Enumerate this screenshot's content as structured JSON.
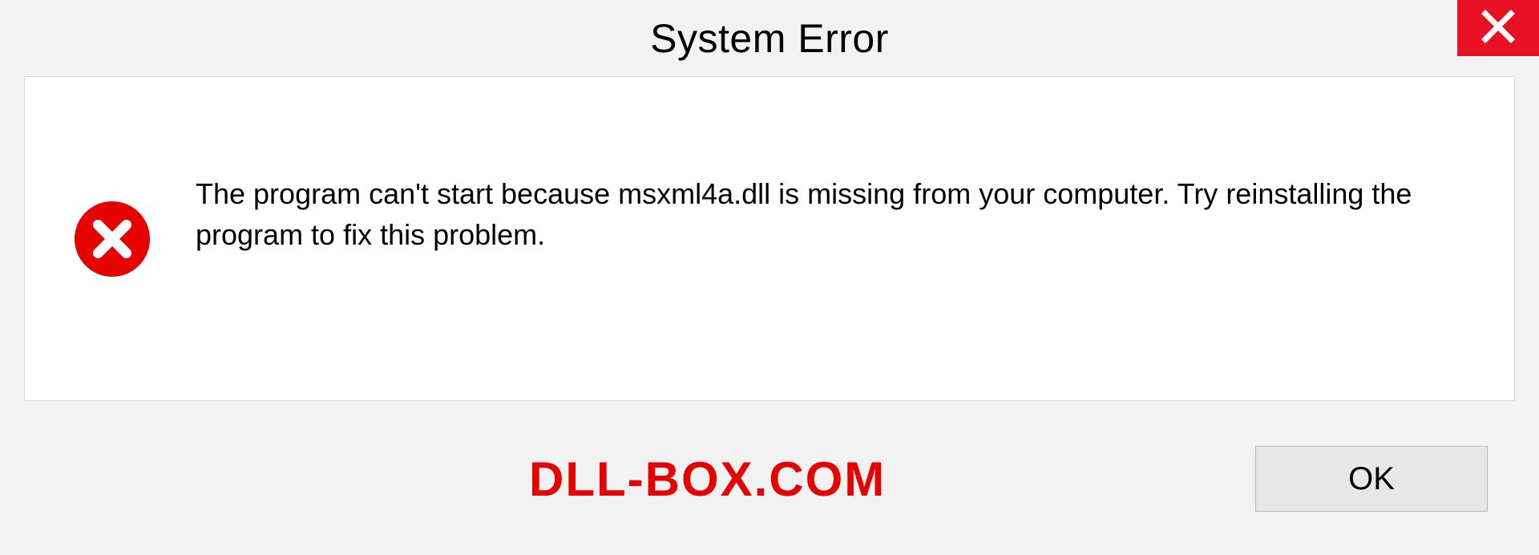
{
  "dialog": {
    "title": "System Error",
    "message": "The program can't start because msxml4a.dll is missing from your computer. Try reinstalling the program to fix this problem.",
    "ok_label": "OK"
  },
  "watermark": "DLL-BOX.COM"
}
